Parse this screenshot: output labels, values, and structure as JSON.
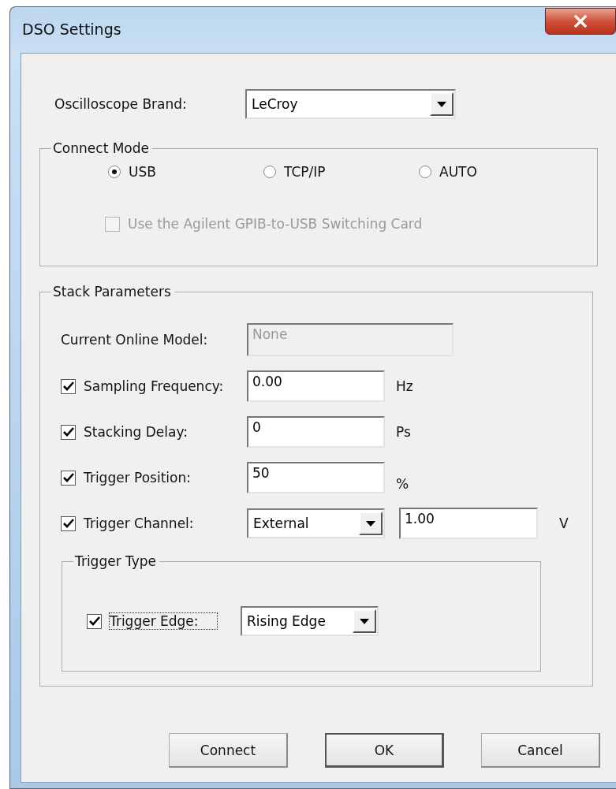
{
  "window": {
    "title": "DSO Settings"
  },
  "brand": {
    "label": "Oscilloscope Brand:",
    "value": "LeCroy"
  },
  "connect_mode": {
    "title": "Connect Mode",
    "options": [
      {
        "label": "USB",
        "selected": true
      },
      {
        "label": "TCP/IP",
        "selected": false
      },
      {
        "label": "AUTO",
        "selected": false
      }
    ],
    "switching_card": {
      "label": "Use the Agilent GPIB-to-USB Switching Card",
      "checked": false,
      "disabled": true
    }
  },
  "stack_parameters": {
    "title": "Stack Parameters",
    "current_online_model": {
      "label": "Current Online Model:",
      "value": "None",
      "disabled": true
    },
    "rows": [
      {
        "kind": "text",
        "label": "Sampling Frequency:",
        "checked": true,
        "value": "0.00",
        "unit": "Hz"
      },
      {
        "kind": "text",
        "label": "Stacking Delay:",
        "checked": true,
        "value": "0",
        "unit": "Ps"
      },
      {
        "kind": "text",
        "label": "Trigger Position:",
        "checked": true,
        "value": "50",
        "unit": "%"
      },
      {
        "kind": "select",
        "label": "Trigger Channel:",
        "checked": true,
        "value": "External",
        "level_value": "1.00",
        "unit": "V"
      }
    ],
    "trigger_type": {
      "title": "Trigger Type",
      "edge": {
        "label": "Trigger Edge:",
        "checked": true,
        "focused": true,
        "value": "Rising Edge"
      }
    }
  },
  "buttons": [
    {
      "label": "Connect",
      "default": false
    },
    {
      "label": "OK",
      "default": true
    },
    {
      "label": "Cancel",
      "default": false
    }
  ]
}
